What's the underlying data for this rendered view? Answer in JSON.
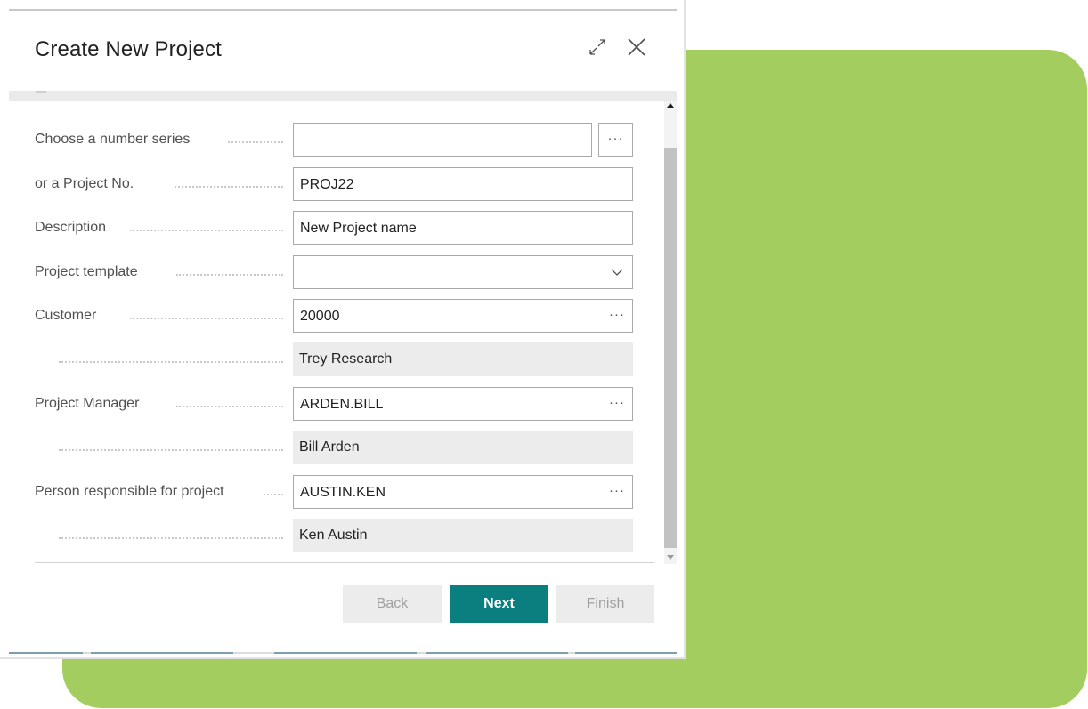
{
  "dialog": {
    "title": "Create New Project",
    "icons": {
      "expand": "expand-icon",
      "close": "close-icon"
    }
  },
  "form": {
    "number_series": {
      "label": "Choose a number series",
      "value": "",
      "assist": "···"
    },
    "project_no": {
      "label": "or a Project No.",
      "value": "PROJ22"
    },
    "description": {
      "label": "Description",
      "value": "New Project name"
    },
    "project_template": {
      "label": "Project template",
      "value": ""
    },
    "customer": {
      "label": "Customer",
      "value": "20000",
      "assist": "···",
      "name": "Trey Research"
    },
    "project_manager": {
      "label": "Project Manager",
      "value": "ARDEN.BILL",
      "assist": "···",
      "name": "Bill Arden"
    },
    "person_responsible": {
      "label": "Person responsible for project",
      "value": "AUSTIN.KEN",
      "assist": "···",
      "name": "Ken Austin"
    }
  },
  "buttons": {
    "back": "Back",
    "next": "Next",
    "finish": "Finish"
  },
  "colors": {
    "accent": "#0b7e7f",
    "background_panel": "#a3ce5f",
    "readonly_field": "#ececec"
  }
}
